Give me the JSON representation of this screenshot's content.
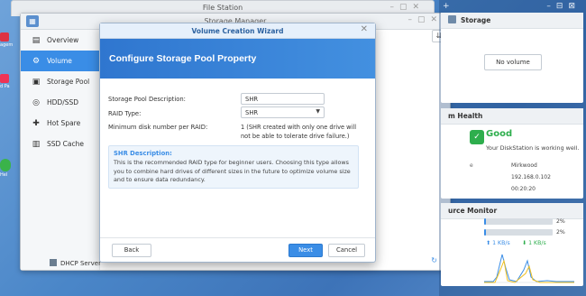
{
  "desktop": {
    "icon_labels": [
      "agem",
      "d Pa",
      "Hel"
    ]
  },
  "file_station": {
    "title": "File Station"
  },
  "storage_manager": {
    "title": "Storage Manager",
    "sidebar": [
      {
        "label": "Overview",
        "icon": "overview-icon"
      },
      {
        "label": "Volume",
        "icon": "volume-icon",
        "active": true
      },
      {
        "label": "Storage Pool",
        "icon": "storage-pool-icon"
      },
      {
        "label": "HDD/SSD",
        "icon": "hdd-icon"
      },
      {
        "label": "Hot Spare",
        "icon": "hot-spare-icon"
      },
      {
        "label": "SSD Cache",
        "icon": "ssd-cache-icon"
      }
    ],
    "dhcp_label": "DHCP Server"
  },
  "wizard": {
    "title": "Volume Creation Wizard",
    "banner": "Configure Storage Pool Property",
    "fields": {
      "desc_label": "Storage Pool Description:",
      "desc_value": "SHR",
      "raid_label": "RAID Type:",
      "raid_value": "SHR",
      "min_label": "Minimum disk number per RAID:",
      "min_value": "1 (SHR created with only one drive will not be able to tolerate drive failure.)"
    },
    "description": {
      "title": "SHR Description:",
      "text": "This is the recommended RAID type for beginner users. Choosing this type allows you to combine hard drives of different sizes in the future to optimize volume size and to ensure data redundancy."
    },
    "buttons": {
      "back": "Back",
      "next": "Next",
      "cancel": "Cancel"
    },
    "colors": {
      "accent": "#3a8de6",
      "banner": "#2f76cf"
    }
  },
  "widgets": {
    "storage": {
      "title": "Storage",
      "no_volume": "No volume"
    },
    "health": {
      "title": "m Health",
      "status": "Good",
      "subtitle": "Your DiskStation is working well.",
      "rows": [
        {
          "label": "e",
          "value": "Mirkwood"
        },
        {
          "label": "",
          "value": "192.168.0.102"
        },
        {
          "label": "",
          "value": "00:20:20"
        }
      ]
    },
    "resource": {
      "title": "urce Monitor",
      "cpu_pct": "2%",
      "ram_pct": "2%",
      "cpu_fill": 0.02,
      "ram_fill": 0.02,
      "upload": "1 KB/s",
      "download": "1 KB/s"
    }
  }
}
